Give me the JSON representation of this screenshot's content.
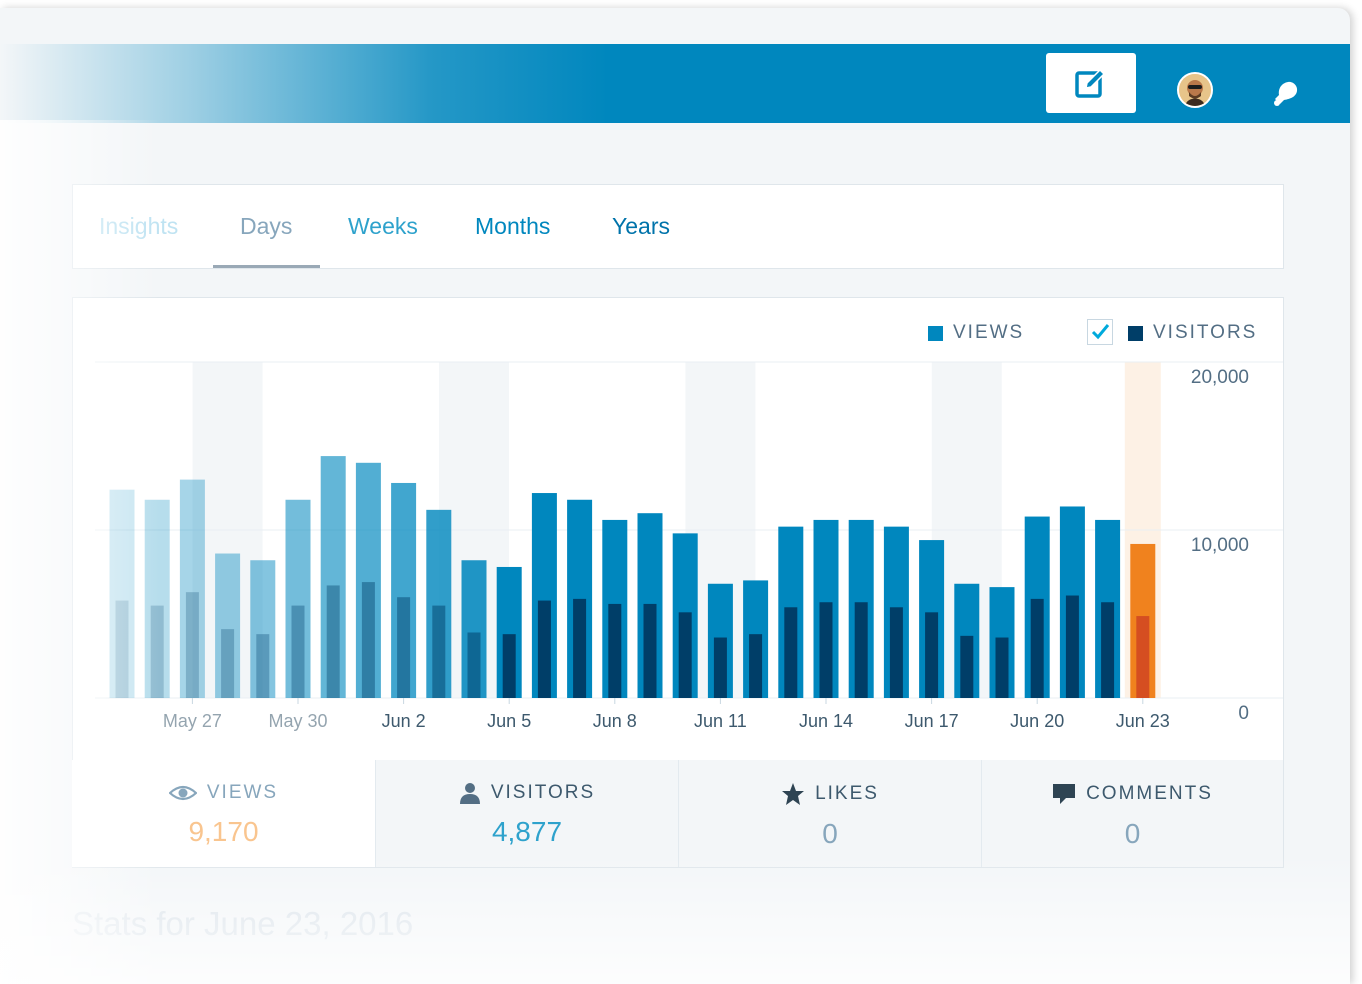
{
  "header": {
    "write_icon": "edit-icon",
    "avatar_icon": "user-avatar",
    "notification_icon": "bell-icon"
  },
  "tabs": [
    {
      "label": "Insights",
      "color": "#bfe3f2"
    },
    {
      "label": "Days",
      "color": "#87a6bc",
      "selected": true
    },
    {
      "label": "Weeks",
      "color": "#2ea2cc"
    },
    {
      "label": "Months",
      "color": "#0087be"
    },
    {
      "label": "Years",
      "color": "#0073aa"
    }
  ],
  "legend": {
    "views": "VIEWS",
    "visitors": "VISITORS",
    "visitors_checked": true
  },
  "chart_data": {
    "type": "bar",
    "y_ticks": [
      "20,000",
      "10,000",
      "0"
    ],
    "ylim": [
      0,
      20000
    ],
    "x_tick_labels": [
      "May 27",
      "May 30",
      "Jun 2",
      "Jun 5",
      "Jun 8",
      "Jun 11",
      "Jun 14",
      "Jun 17",
      "Jun 20",
      "Jun 23"
    ],
    "categories": [
      "May 25",
      "May 26",
      "May 27",
      "May 28",
      "May 29",
      "May 30",
      "May 31",
      "Jun 1",
      "Jun 2",
      "Jun 3",
      "Jun 4",
      "Jun 5",
      "Jun 6",
      "Jun 7",
      "Jun 8",
      "Jun 9",
      "Jun 10",
      "Jun 11",
      "Jun 12",
      "Jun 13",
      "Jun 14",
      "Jun 15",
      "Jun 16",
      "Jun 17",
      "Jun 18",
      "Jun 19",
      "Jun 20",
      "Jun 21",
      "Jun 22",
      "Jun 23"
    ],
    "series": [
      {
        "name": "VIEWS",
        "color": "#0087be",
        "values": [
          12400,
          11800,
          13000,
          8600,
          8200,
          11800,
          14400,
          14000,
          12800,
          11200,
          8200,
          7800,
          12200,
          11800,
          10600,
          11000,
          9800,
          6800,
          7000,
          10200,
          10600,
          10600,
          10200,
          9400,
          6800,
          6600,
          10800,
          11400,
          10600,
          9170
        ]
      },
      {
        "name": "VISITORS",
        "color": "#003e68",
        "values": [
          5800,
          5500,
          6300,
          4100,
          3800,
          5500,
          6700,
          6900,
          6000,
          5500,
          3900,
          3800,
          5800,
          5900,
          5600,
          5600,
          5100,
          3600,
          3800,
          5400,
          5700,
          5700,
          5400,
          5100,
          3700,
          3600,
          5900,
          6100,
          5700,
          4877
        ]
      }
    ],
    "highlight_index": 29,
    "highlight_color": "#f0821e",
    "highlight_visitors_color": "#d54e21",
    "weekend_shade_indices": [
      3,
      10,
      17,
      24,
      29
    ]
  },
  "summary": {
    "views": {
      "label": "VIEWS",
      "value": "9,170",
      "icon": "eye-icon"
    },
    "visitors": {
      "label": "VISITORS",
      "value": "4,877",
      "icon": "person-icon"
    },
    "likes": {
      "label": "LIKES",
      "value": "0",
      "icon": "star-icon"
    },
    "comments": {
      "label": "COMMENTS",
      "value": "0",
      "icon": "comment-icon"
    }
  },
  "footer": {
    "title": "Stats for June 23, 2016"
  }
}
